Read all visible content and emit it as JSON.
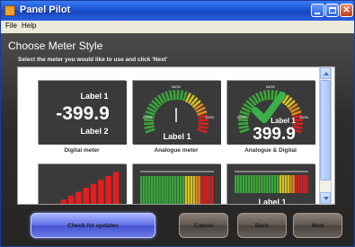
{
  "window": {
    "title": "Panel Pilot"
  },
  "menu": {
    "file": "File",
    "help": "Help"
  },
  "page": {
    "heading": "Choose Meter Style",
    "instruction": "Select the meter you would like to use and click 'Next'"
  },
  "meters": [
    {
      "label": "Digital meter",
      "line1": "Label 1",
      "value": "-399.9",
      "line2": "Label 2"
    },
    {
      "label": "Analogue meter",
      "scale_min": "000%",
      "scale_mid": "050%",
      "scale_max": "100%",
      "meter_label": "Label 1"
    },
    {
      "label": "Analogue & Digital",
      "scale_min": "000%",
      "scale_mid": "050%",
      "scale_max": "100%",
      "meter_label": "Label 1",
      "value": "399.9",
      "selected": true
    },
    {
      "label": ""
    },
    {
      "label": ""
    },
    {
      "label": "",
      "meter_label": "Label 1"
    }
  ],
  "buttons": {
    "update": "Check for updates",
    "cancel": "Cancel",
    "back": "Back",
    "next": "Next"
  },
  "colors": {
    "titlebar": "#1d53d6",
    "update_button": "#5f6ee8",
    "check_mark": "#3bb54a"
  }
}
